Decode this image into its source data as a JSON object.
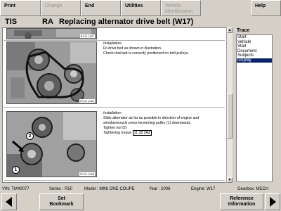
{
  "toolbar": {
    "print": "Print",
    "change": "Change",
    "end": "End",
    "utilities": "Utilities",
    "vehicle_identification": "Vehicle Identification",
    "help": "Help"
  },
  "header": {
    "app": "TIS",
    "code": "RA",
    "title": "Replacing alternator drive belt (W17)"
  },
  "content": {
    "images": [
      {
        "caption": "RX11 1187"
      },
      {
        "caption": "RX11 1082"
      },
      {
        "caption": "RX11 1083"
      }
    ],
    "sections": [
      {
        "heading": "Installation:",
        "lines": [
          "Fit drive belt as shown in illustration.",
          "Check that belt is correctly positioned on belt pulleys."
        ]
      },
      {
        "heading": "Installation:",
        "lines": [
          "Slide alternator as far as possible in direction of engine and",
          "simultaneously press tensioning pulley (1) downwards.",
          "Tighten nut (2)"
        ],
        "torque_label": "Tightening torque",
        "torque_ref": "11 28 2AZ"
      }
    ],
    "callouts": [
      "2",
      "1"
    ]
  },
  "trace": {
    "label": "Trace",
    "items": [
      "Start",
      "Vehicle",
      "Start",
      "Document",
      "Subjects",
      "Display"
    ],
    "selected_index": 5
  },
  "status": {
    "vin": "VIN: TM40077",
    "series": "Series : R50",
    "model": "Model : MINI ONE COUPE",
    "year": "Year : 2006",
    "engine": "Engine: W17",
    "gearbox": "Gearbox: MECH"
  },
  "bottom": {
    "set_bookmark_line1": "Set",
    "set_bookmark_line2": "Bookmark",
    "ref_info_line1": "Reference",
    "ref_info_line2": "Information"
  }
}
